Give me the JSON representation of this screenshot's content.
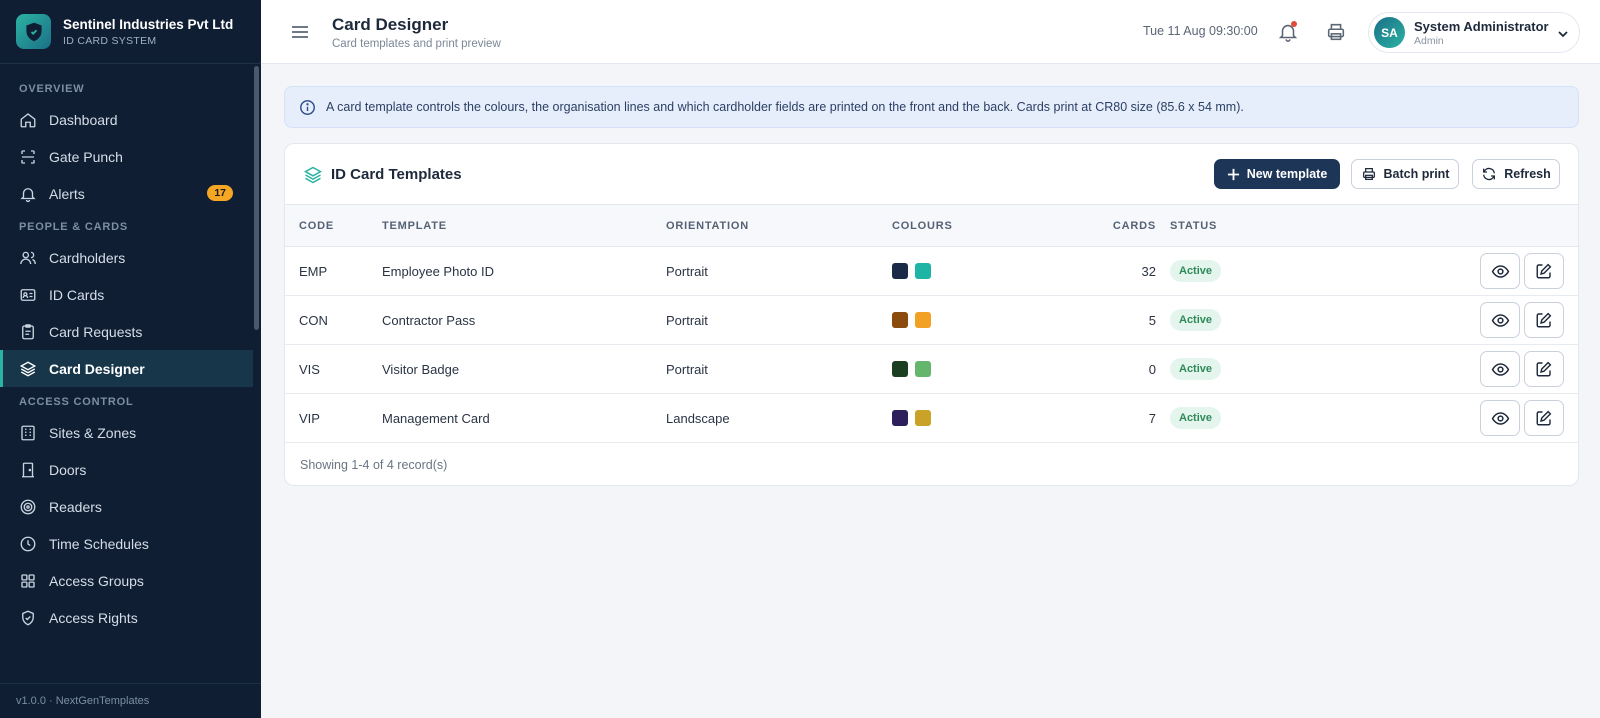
{
  "brand": {
    "name": "Sentinel Industries Pvt Ltd",
    "subtitle": "ID CARD SYSTEM"
  },
  "sidebar": {
    "sections": [
      {
        "title": "OVERVIEW",
        "items": [
          {
            "label": "Dashboard",
            "icon": "home-icon"
          },
          {
            "label": "Gate Punch",
            "icon": "scan-icon"
          },
          {
            "label": "Alerts",
            "icon": "bell-icon",
            "badge": "17"
          }
        ]
      },
      {
        "title": "PEOPLE & CARDS",
        "items": [
          {
            "label": "Cardholders",
            "icon": "users-icon"
          },
          {
            "label": "ID Cards",
            "icon": "id-card-icon"
          },
          {
            "label": "Card Requests",
            "icon": "clipboard-icon"
          },
          {
            "label": "Card Designer",
            "icon": "layers-icon",
            "active": true
          }
        ]
      },
      {
        "title": "ACCESS CONTROL",
        "items": [
          {
            "label": "Sites & Zones",
            "icon": "building-icon"
          },
          {
            "label": "Doors",
            "icon": "door-icon"
          },
          {
            "label": "Readers",
            "icon": "target-icon"
          },
          {
            "label": "Time Schedules",
            "icon": "clock-icon"
          },
          {
            "label": "Access Groups",
            "icon": "grid-icon"
          },
          {
            "label": "Access Rights",
            "icon": "shield-icon"
          }
        ]
      }
    ],
    "footer": "v1.0.0 · NextGenTemplates"
  },
  "header": {
    "title": "Card Designer",
    "subtitle": "Card templates and print preview",
    "datetime": "Tue 11 Aug 09:30:00",
    "user": {
      "initials": "SA",
      "name": "System Administrator",
      "role": "Admin"
    }
  },
  "info_text": "A card template controls the colours, the organisation lines and which cardholder fields are printed on the front and the back. Cards print at CR80 size (85.6 x 54 mm).",
  "panel": {
    "title": "ID Card Templates",
    "buttons": {
      "new": "New template",
      "batch": "Batch print",
      "refresh": "Refresh"
    },
    "columns": [
      "CODE",
      "TEMPLATE",
      "ORIENTATION",
      "COLOURS",
      "CARDS",
      "STATUS"
    ],
    "rows": [
      {
        "code": "EMP",
        "template": "Employee Photo ID",
        "orientation": "Portrait",
        "colours": [
          "#1b2a47",
          "#1fb5a5"
        ],
        "cards": "32",
        "status": "Active"
      },
      {
        "code": "CON",
        "template": "Contractor Pass",
        "orientation": "Portrait",
        "colours": [
          "#8a4b0c",
          "#f2a124"
        ],
        "cards": "5",
        "status": "Active"
      },
      {
        "code": "VIS",
        "template": "Visitor Badge",
        "orientation": "Portrait",
        "colours": [
          "#1c3f22",
          "#63b66b"
        ],
        "cards": "0",
        "status": "Active"
      },
      {
        "code": "VIP",
        "template": "Management Card",
        "orientation": "Landscape",
        "colours": [
          "#2c1f5c",
          "#c9a227"
        ],
        "cards": "7",
        "status": "Active"
      }
    ],
    "footer": "Showing 1-4 of 4 record(s)"
  }
}
